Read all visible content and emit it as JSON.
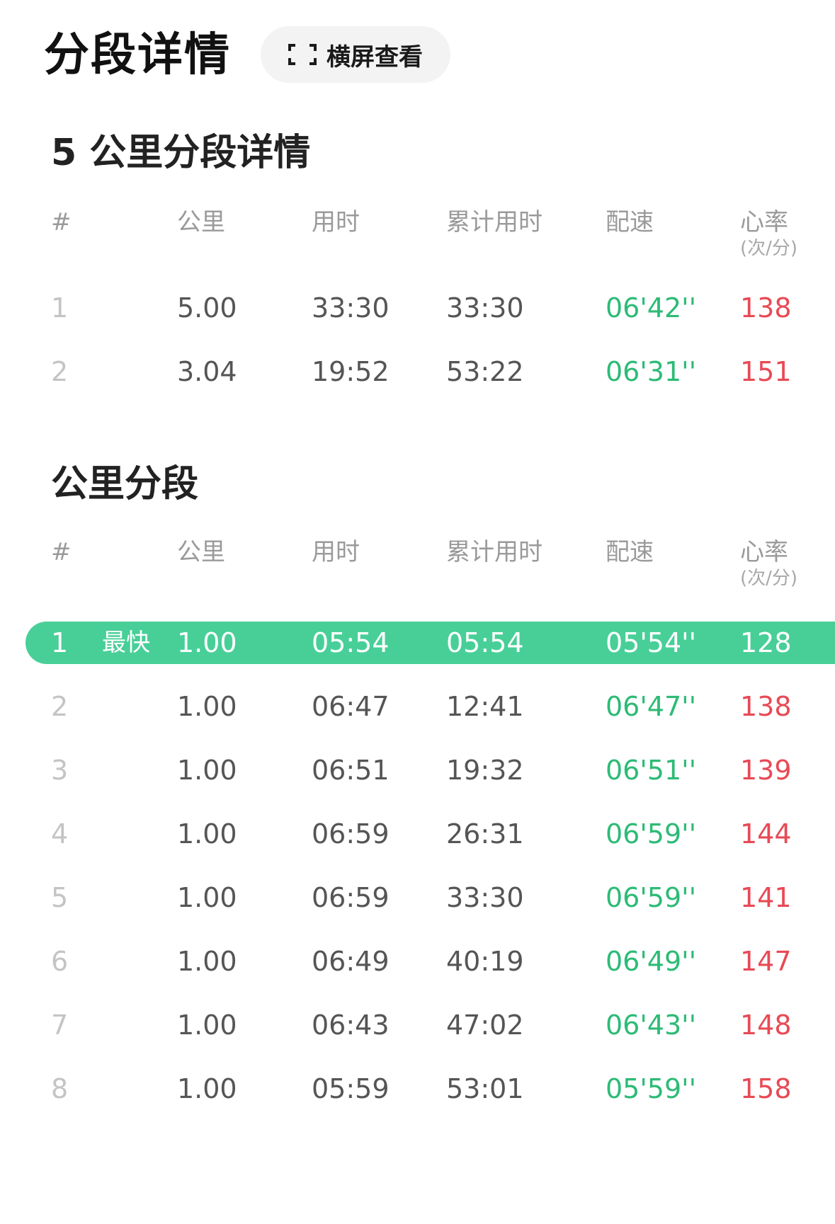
{
  "header": {
    "title": "分段详情",
    "landscape_button": "横屏查看"
  },
  "columns": {
    "idx": "#",
    "km": "公里",
    "time": "用时",
    "total": "累计用时",
    "pace": "配速",
    "hr": "心率",
    "hr_unit": "(次/分)"
  },
  "section_5km": {
    "title": "5 公里分段详情",
    "rows": [
      {
        "idx": "1",
        "km": "5.00",
        "time": "33:30",
        "total": "33:30",
        "pace": "06'42''",
        "hr": "138"
      },
      {
        "idx": "2",
        "km": "3.04",
        "time": "19:52",
        "total": "53:22",
        "pace": "06'31''",
        "hr": "151"
      }
    ]
  },
  "section_1km": {
    "title": "公里分段",
    "fastest_badge": "最快",
    "rows": [
      {
        "idx": "1",
        "km": "1.00",
        "time": "05:54",
        "total": "05:54",
        "pace": "05'54''",
        "hr": "128"
      },
      {
        "idx": "2",
        "km": "1.00",
        "time": "06:47",
        "total": "12:41",
        "pace": "06'47''",
        "hr": "138"
      },
      {
        "idx": "3",
        "km": "1.00",
        "time": "06:51",
        "total": "19:32",
        "pace": "06'51''",
        "hr": "139"
      },
      {
        "idx": "4",
        "km": "1.00",
        "time": "06:59",
        "total": "26:31",
        "pace": "06'59''",
        "hr": "144"
      },
      {
        "idx": "5",
        "km": "1.00",
        "time": "06:59",
        "total": "33:30",
        "pace": "06'59''",
        "hr": "141"
      },
      {
        "idx": "6",
        "km": "1.00",
        "time": "06:49",
        "total": "40:19",
        "pace": "06'49''",
        "hr": "147"
      },
      {
        "idx": "7",
        "km": "1.00",
        "time": "06:43",
        "total": "47:02",
        "pace": "06'43''",
        "hr": "148"
      },
      {
        "idx": "8",
        "km": "1.00",
        "time": "05:59",
        "total": "53:01",
        "pace": "05'59''",
        "hr": "158"
      }
    ]
  },
  "colors": {
    "pace": "#2dbb76",
    "heart_rate": "#e84a55",
    "fastest_bg": "#48cf98"
  }
}
